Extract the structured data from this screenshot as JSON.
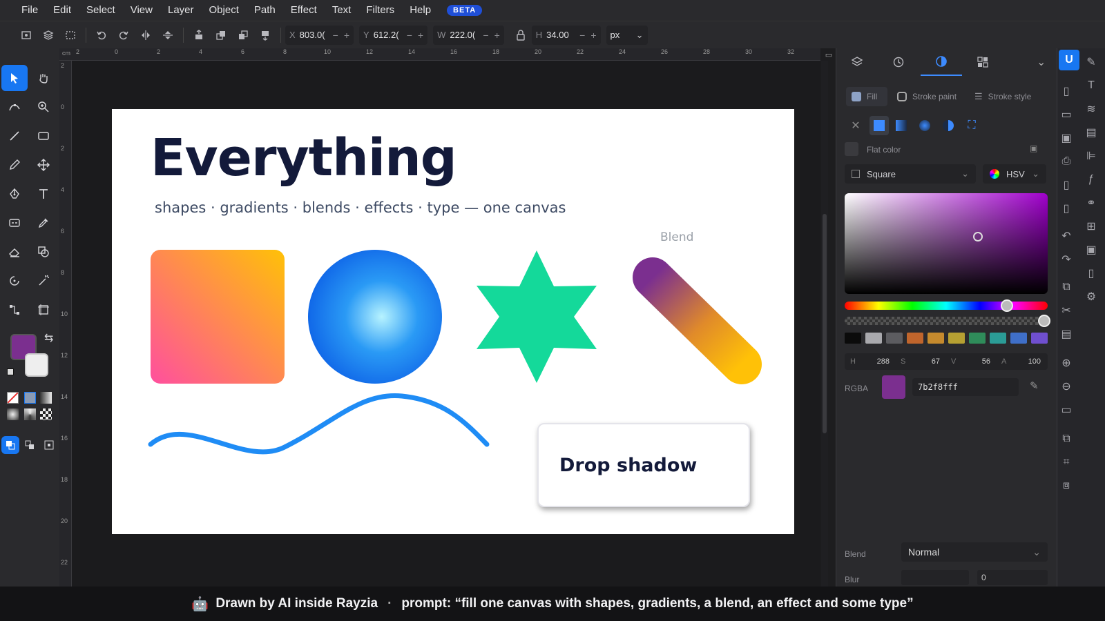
{
  "menu": {
    "items": [
      "File",
      "Edit",
      "Select",
      "View",
      "Layer",
      "Object",
      "Path",
      "Effect",
      "Text",
      "Filters",
      "Help"
    ],
    "badge": "BETA"
  },
  "toolbar": {
    "x_label": "X",
    "x_value": "803.0(",
    "y_label": "Y",
    "y_value": "612.2(",
    "w_label": "W",
    "w_value": "222.0(",
    "h_label": "H",
    "h_value": "34.00",
    "unit": "px",
    "minus": "−",
    "plus": "+"
  },
  "ruler": {
    "unit": "cm",
    "top_ticks": [
      "2",
      "0",
      "2",
      "4",
      "6",
      "8",
      "10",
      "12",
      "14",
      "16",
      "18",
      "20",
      "22",
      "24",
      "26",
      "28",
      "30",
      "32"
    ],
    "left_ticks": [
      "2",
      "0",
      "2",
      "4",
      "6",
      "8",
      "10",
      "12",
      "14",
      "16",
      "18",
      "20",
      "22"
    ]
  },
  "artboard": {
    "headline": "Everything",
    "subline": "shapes · gradients · blends · effects · type — one canvas",
    "blend_label": "Blend",
    "shadow_text": "Drop shadow"
  },
  "panel": {
    "fill_tabs": [
      "Fill",
      "Stroke paint",
      "Stroke style"
    ],
    "flat_color": "Flat color",
    "picker_shape": "Square",
    "color_model": "HSV",
    "hsv": {
      "h_label": "H",
      "h": "288",
      "s_label": "S",
      "s": "67",
      "v_label": "V",
      "v": "56",
      "a_label": "A",
      "a": "100"
    },
    "rgba_label": "RGBA",
    "rgba_value": "7b2f8fff",
    "swatch": "#7b2f8f",
    "swatches": [
      "#0b0b0b",
      "#a9a9ad",
      "#5c5c60",
      "#c0652c",
      "#c58a2d",
      "#b6a032",
      "#2f8c5a",
      "#2b9c96",
      "#3f6fc8",
      "#6f4fcf"
    ],
    "blend_label": "Blend",
    "blend_value": "Normal",
    "blur_label": "Blur",
    "blur_value": "0"
  },
  "banner": {
    "title": "Drawn by AI inside Rayzia",
    "prompt": "prompt: “fill one canvas with shapes, gradients, a blend, an effect and some type”"
  },
  "colors": {
    "accent": "#1877f2",
    "fill_purple": "#7b2f8f"
  }
}
